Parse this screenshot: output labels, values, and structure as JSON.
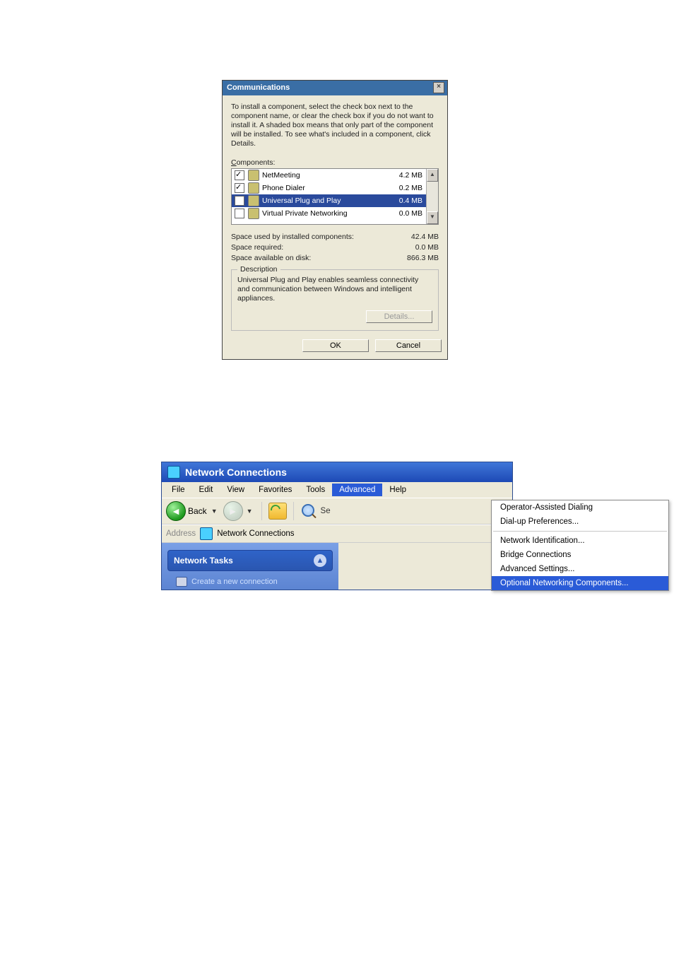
{
  "dialog1": {
    "title": "Communications",
    "intro": "To install a component, select the check box next to the component name, or clear the check box if you do not want to install it. A shaded box means that only part of the component will be installed. To see what's included in a component, click Details.",
    "components_label": "Components:",
    "components": [
      {
        "checked": true,
        "name": "NetMeeting",
        "size": "4.2 MB"
      },
      {
        "checked": true,
        "name": "Phone Dialer",
        "size": "0.2 MB"
      },
      {
        "checked": true,
        "name": "Universal Plug and Play",
        "size": "0.4 MB",
        "selected": true
      },
      {
        "checked": false,
        "name": "Virtual Private Networking",
        "size": "0.0 MB"
      }
    ],
    "stats": {
      "used_label": "Space used by installed components:",
      "used_value": "42.4 MB",
      "req_label": "Space required:",
      "req_value": "0.0 MB",
      "avail_label": "Space available on disk:",
      "avail_value": "866.3 MB"
    },
    "description_label": "Description",
    "description_text": "Universal Plug and Play enables seamless connectivity and communication between Windows and intelligent appliances.",
    "details_button": "Details...",
    "ok_button": "OK",
    "cancel_button": "Cancel"
  },
  "window2": {
    "title": "Network Connections",
    "menu": [
      "File",
      "Edit",
      "View",
      "Favorites",
      "Tools",
      "Advanced",
      "Help"
    ],
    "menu_open_index": 5,
    "toolbar": {
      "back": "Back",
      "search_cut": "Se"
    },
    "address_label": "Address",
    "address_value": "Network Connections",
    "network_tasks": "Network Tasks",
    "task_item": "Create a new connection",
    "dropdown": [
      {
        "label": "Operator-Assisted Dialing"
      },
      {
        "label": "Dial-up Preferences..."
      },
      {
        "sep": true
      },
      {
        "label": "Network Identification..."
      },
      {
        "label": "Bridge Connections"
      },
      {
        "label": "Advanced Settings..."
      },
      {
        "label": "Optional Networking Components...",
        "hl": true
      }
    ]
  }
}
